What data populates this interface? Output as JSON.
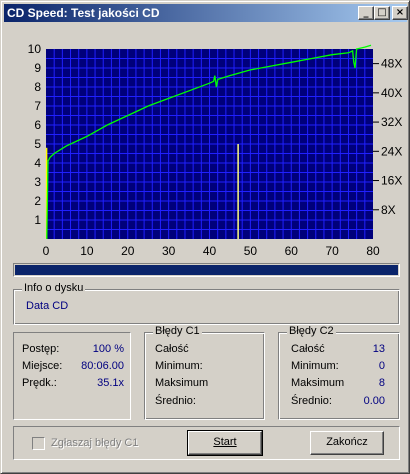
{
  "window": {
    "title": "CD Speed: Test jakości CD",
    "minimize_glyph": "_",
    "maximize_glyph": "□",
    "close_glyph": "×"
  },
  "chart_data": {
    "type": "line",
    "x_axis": {
      "range": [
        0,
        80
      ],
      "ticks": [
        "0",
        "10",
        "20",
        "30",
        "40",
        "50",
        "60",
        "70",
        "80"
      ]
    },
    "y_left_axis": {
      "range": [
        0,
        10
      ],
      "ticks": [
        "1",
        "2",
        "3",
        "4",
        "5",
        "6",
        "7",
        "8",
        "9",
        "10"
      ]
    },
    "y_right_axis": {
      "range": [
        0,
        52
      ],
      "ticks": [
        "8X",
        "16X",
        "24X",
        "32X",
        "40X",
        "48X"
      ]
    },
    "grid": true,
    "background_color": "#00007b",
    "grid_color": "#2020ff",
    "series": [
      {
        "color": "#00ff00",
        "x": [
          0.2,
          0.5,
          1,
          2,
          5,
          10,
          15,
          20,
          25,
          30,
          35,
          40,
          41,
          41.3,
          41.7,
          42,
          45,
          50,
          55,
          60,
          65,
          70,
          74,
          75,
          75.3,
          75.6,
          76,
          78,
          79.5
        ],
        "y": [
          0,
          4.1,
          4.3,
          4.5,
          4.9,
          5.4,
          6.0,
          6.5,
          7.0,
          7.4,
          7.8,
          8.2,
          8.3,
          8.6,
          8.0,
          8.4,
          8.6,
          8.9,
          9.1,
          9.3,
          9.5,
          9.7,
          9.8,
          9.9,
          9.3,
          9.0,
          10.0,
          10.1,
          10.2
        ]
      }
    ],
    "c2_errors": {
      "color": "#ffff80",
      "points": [
        {
          "x": 47,
          "y": 5.0
        }
      ]
    }
  },
  "progress": {
    "fraction": 1.0
  },
  "disc_info": {
    "title": "Info o dysku",
    "type": "Data CD"
  },
  "status": {
    "progress_label": "Postęp:",
    "progress_value": "100 %",
    "position_label": "Miejsce:",
    "position_value": "80:06.00",
    "speed_label": "Prędk.:",
    "speed_value": "35.1x"
  },
  "c1": {
    "title": "Błędy C1",
    "total_label": "Całość",
    "total_value": "",
    "min_label": "Minimum:",
    "min_value": "",
    "max_label": "Maksimum",
    "max_value": "",
    "avg_label": "Średnio:",
    "avg_value": ""
  },
  "c2": {
    "title": "Błędy C2",
    "total_label": "Całość",
    "total_value": "13",
    "min_label": "Minimum:",
    "min_value": "0",
    "max_label": "Maksimum",
    "max_value": "8",
    "avg_label": "Średnio:",
    "avg_value": "0.00"
  },
  "controls": {
    "report_c1_label": "Zgłaszaj błędy C1",
    "report_c1_checked": false,
    "start_label": "Start",
    "close_label": "Zakończ"
  }
}
